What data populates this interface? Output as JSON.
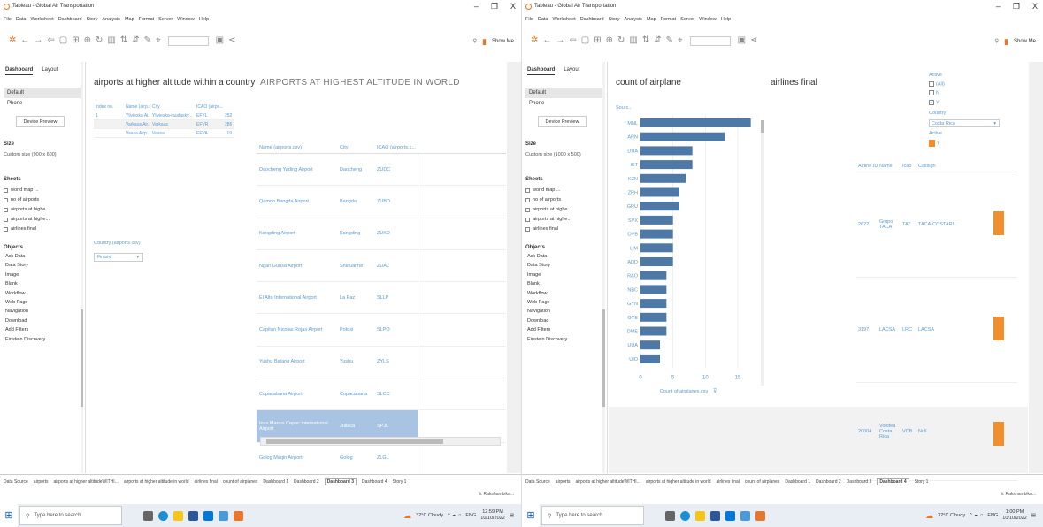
{
  "app": {
    "title": "Tableau - Global Air Transportation",
    "menu": [
      "File",
      "Data",
      "Worksheet",
      "Dashboard",
      "Story",
      "Analysis",
      "Map",
      "Format",
      "Server",
      "Window",
      "Help"
    ],
    "window_controls": [
      "–",
      "❐",
      "X"
    ],
    "show_me": "Show Me"
  },
  "taskbar": {
    "search_placeholder": "Type here to search",
    "weather": "32°C Cloudy",
    "lang": "ENG",
    "region": "IN",
    "date": "10/10/2022"
  },
  "left": {
    "time": "12:59 PM",
    "sidebar": {
      "tabs": [
        "Dashboard",
        "Layout"
      ],
      "devices": [
        "Default",
        "Phone"
      ],
      "device_preview": "Device Preview",
      "size_label": "Size",
      "size_value": "Custom size (900 x 600)",
      "sheets_label": "Sheets",
      "sheets": [
        "world map ...",
        "no of airports",
        "airports at highe...",
        "airports at highe...",
        "airlines final"
      ],
      "objects_label": "Objects",
      "objects": [
        "Ask Data",
        "Data Story",
        "Image",
        "Blank",
        "Workflow",
        "Web Page",
        "Navigation",
        "Download",
        "Add Filters",
        "Einstein Discovery"
      ]
    },
    "dash": {
      "title_a": "airports at higher altitude within a country",
      "title_b": "AIRPORTS AT HIGHEST ALTITUDE IN WORLD",
      "small_table": {
        "headers": [
          "index no.",
          "Name (airp...",
          "City",
          "ICAO (airpo...",
          ""
        ],
        "rows": [
          [
            "1",
            "Ylivieska Ai...",
            "Ylivieska-raudasky...",
            "EFYL",
            "252"
          ],
          [
            "",
            "Varkaus Air...",
            "Varkaus",
            "EFVR",
            "286"
          ],
          [
            "",
            "Vaasa Airp...",
            "Vaasa",
            "EFVA",
            "19"
          ]
        ]
      },
      "country_filter_label": "Country (airports.csv)",
      "country_filter_value": "Finland",
      "alt_table": {
        "headers": [
          "Name (airports.csv)",
          "City",
          "ICAO (airports.c..."
        ],
        "rows": [
          [
            "Daocheng Yading Airport",
            "Daocheng",
            "ZUDC"
          ],
          [
            "Qamdo Bangda Airport",
            "Bangda",
            "ZUBD"
          ],
          [
            "Kangding Airport",
            "Kangding",
            "ZUKD"
          ],
          [
            "Ngari Gunsa Airport",
            "Shiquanhe",
            "ZUAL"
          ],
          [
            "El Alto International Airport",
            "La Paz",
            "SLLP"
          ],
          [
            "Capitan Nicolas Rojas Airport",
            "Potosi",
            "SLPO"
          ],
          [
            "Yushu Batang Airport",
            "Yushu",
            "ZYLS"
          ],
          [
            "Copacabana Airport",
            "Copacabana",
            "SLCC"
          ],
          [
            "Inca Manco Capac International Airport",
            "Juliaca",
            "SPJL"
          ],
          [
            "Golog Maqin Airport",
            "Golog",
            "ZLGL"
          ]
        ]
      }
    },
    "bottom_tabs": [
      "Data Source",
      "airports",
      "airports at higher altitudeWITHI...",
      "airports at higher altitude in world",
      "airlines final",
      "count of airplanes",
      "Dashboard 1",
      "Dashboard 2",
      "Dashboard 3",
      "Dashboard 4",
      "Story 1"
    ],
    "active_tab": "Dashboard 3",
    "status_user": "Rakshambika..."
  },
  "right": {
    "time": "1:00 PM",
    "sidebar": {
      "tabs": [
        "Dashboard",
        "Layout"
      ],
      "devices": [
        "Default",
        "Phone"
      ],
      "device_preview": "Device Preview",
      "size_label": "Size",
      "size_value": "Custom size (1000 x 500)",
      "sheets_label": "Sheets",
      "sheets": [
        "world map ...",
        "no of airports",
        "airports at highe...",
        "airports at highe...",
        "airlines final"
      ],
      "objects_label": "Objects",
      "objects": [
        "Ask Data",
        "Data Story",
        "Image",
        "Blank",
        "Workflow",
        "Web Page",
        "Navigation",
        "Download",
        "Add Filters",
        "Einstein Discovery"
      ]
    },
    "dash": {
      "title_a": "count of airplane",
      "title_b": "airlines final",
      "chart_yheader": "Sourc..",
      "chart_xlabel": "Count of airplanes.csv",
      "airlines_headers": [
        "Airline ID",
        "Name",
        "Icao",
        "Callsign"
      ],
      "airlines_rows": [
        [
          "2622",
          "Grupo TACA",
          "TAT",
          "TACA-COSTARI..."
        ],
        [
          "3197",
          "LACSA",
          "LRC",
          "LACSA"
        ],
        [
          "20004",
          "Volotea Costa Rica",
          "VCB",
          "Null"
        ]
      ],
      "filters": {
        "active_label": "Active",
        "active_options": [
          "(All)",
          "N",
          "Y"
        ],
        "country_label": "Country",
        "country_value": "Costa Rica",
        "active2_label": "Active",
        "legend_y": "Y"
      }
    },
    "bottom_tabs": [
      "Data Source",
      "airports",
      "airports at higher altitudeWITHI...",
      "airports at higher altitude in world",
      "airlines final",
      "count of airplanes",
      "Dashboard 1",
      "Dashboard 2",
      "Dashboard 3",
      "Dashboard 4",
      "Story 1"
    ],
    "active_tab": "Dashboard 4",
    "status_user": "Rakshambika..."
  },
  "chart_data": {
    "type": "bar",
    "orientation": "horizontal",
    "categories": [
      "MNL",
      "ARN",
      "DUA",
      "IKT",
      "KZN",
      "ZRH",
      "GRU",
      "SVX",
      "OVB",
      "LIM",
      "ADD",
      "RAO",
      "NBC",
      "GYN",
      "GYE",
      "DME",
      "UUA",
      "UIO"
    ],
    "values": [
      17,
      13,
      8,
      8,
      7,
      6,
      6,
      5,
      5,
      5,
      5,
      4,
      4,
      4,
      4,
      4,
      3,
      3
    ],
    "xlabel": "Count of airplanes.csv",
    "xticks": [
      0,
      5,
      10,
      15
    ],
    "xlim": [
      0,
      18
    ],
    "bar_color": "#4e79a7"
  }
}
